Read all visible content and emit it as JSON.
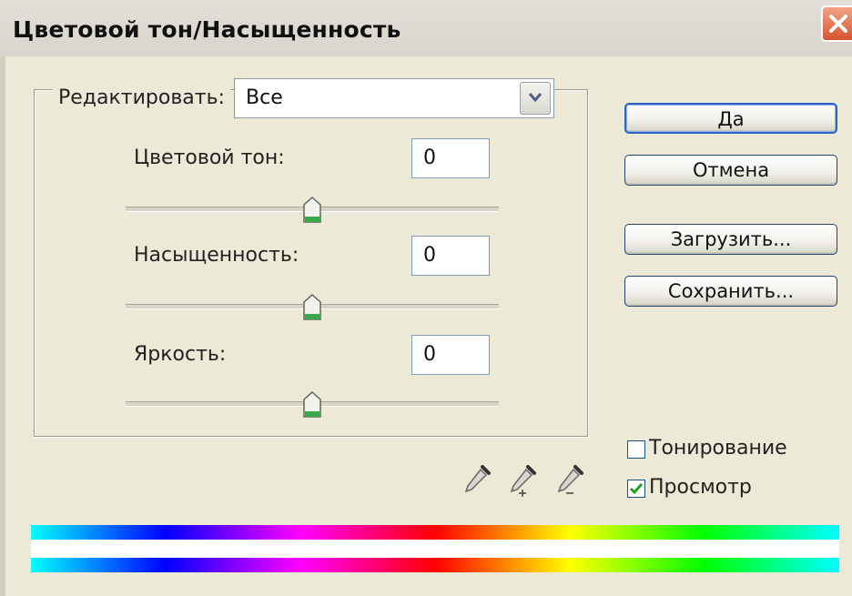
{
  "window": {
    "title": "Цветовой тон/Насыщенность"
  },
  "edit": {
    "label": "Редактировать:",
    "selected": "Все"
  },
  "adjustments": [
    {
      "label": "Цветовой тон:",
      "value": "0",
      "slider_level": 0.5
    },
    {
      "label": "Насыщенность:",
      "value": "0",
      "slider_level": 0.5
    },
    {
      "label": "Яркость:",
      "value": "0",
      "slider_level": 0.5
    }
  ],
  "buttons": {
    "ok": "Да",
    "cancel": "Отмена",
    "load": "Загрузить...",
    "save": "Сохранить..."
  },
  "options": {
    "colorize": {
      "label": "Тонирование",
      "checked": false
    },
    "preview": {
      "label": "Просмотр",
      "checked": true
    }
  },
  "icons": [
    "close-icon",
    "dropdown-arrow-icon",
    "eyedropper-icon",
    "eyedropper-plus-icon",
    "eyedropper-minus-icon",
    "slider-thumb-icon",
    "checkmark-icon"
  ],
  "colors": {
    "title_close_button": "#d8522e",
    "thumb_green": "#3aa84a",
    "default_button_border": "#2e63c3",
    "checkmark": "#21a121"
  },
  "spectrum": {
    "stops": [
      "#00ffff",
      "#0000ff",
      "#ff00ff",
      "#ff0000",
      "#ffff00",
      "#00ff00",
      "#00ffff"
    ]
  }
}
